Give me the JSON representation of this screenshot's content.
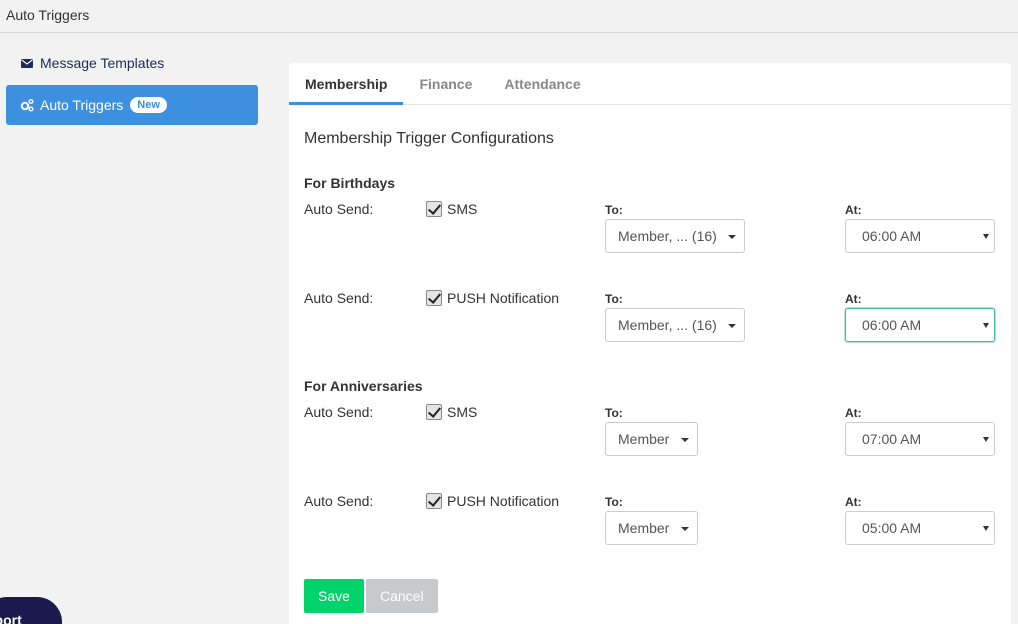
{
  "header": {
    "title": "Auto Triggers"
  },
  "sidebar": {
    "items": [
      {
        "label": "Message Templates",
        "icon": "envelope-icon"
      },
      {
        "label": "Auto Triggers",
        "icon": "gears-icon",
        "badge": "New"
      }
    ]
  },
  "tabs": [
    {
      "label": "Membership"
    },
    {
      "label": "Finance"
    },
    {
      "label": "Attendance"
    }
  ],
  "section_title": "Membership Trigger Configurations",
  "groups": [
    {
      "title": "For Birthdays",
      "rows": [
        {
          "auto_label": "Auto Send:",
          "channel": "SMS",
          "to_label": "To:",
          "to_value": "Member, ... (16)",
          "at_label": "At:",
          "at_value": "06:00 AM"
        },
        {
          "auto_label": "Auto Send:",
          "channel": "PUSH Notification",
          "to_label": "To:",
          "to_value": "Member, ... (16)",
          "at_label": "At:",
          "at_value": "06:00 AM"
        }
      ]
    },
    {
      "title": "For Anniversaries",
      "rows": [
        {
          "auto_label": "Auto Send:",
          "channel": "SMS",
          "to_label": "To:",
          "to_value": "Member",
          "at_label": "At:",
          "at_value": "07:00 AM"
        },
        {
          "auto_label": "Auto Send:",
          "channel": "PUSH Notification",
          "to_label": "To:",
          "to_value": "Member",
          "at_label": "At:",
          "at_value": "05:00 AM"
        }
      ]
    }
  ],
  "buttons": {
    "save": "Save",
    "cancel": "Cancel"
  },
  "support": {
    "label": "pport"
  },
  "colors": {
    "accent": "#3d8fe0",
    "save": "#00d36a",
    "cancel": "#c7c9cc",
    "support_bg": "#1a1a4e"
  }
}
